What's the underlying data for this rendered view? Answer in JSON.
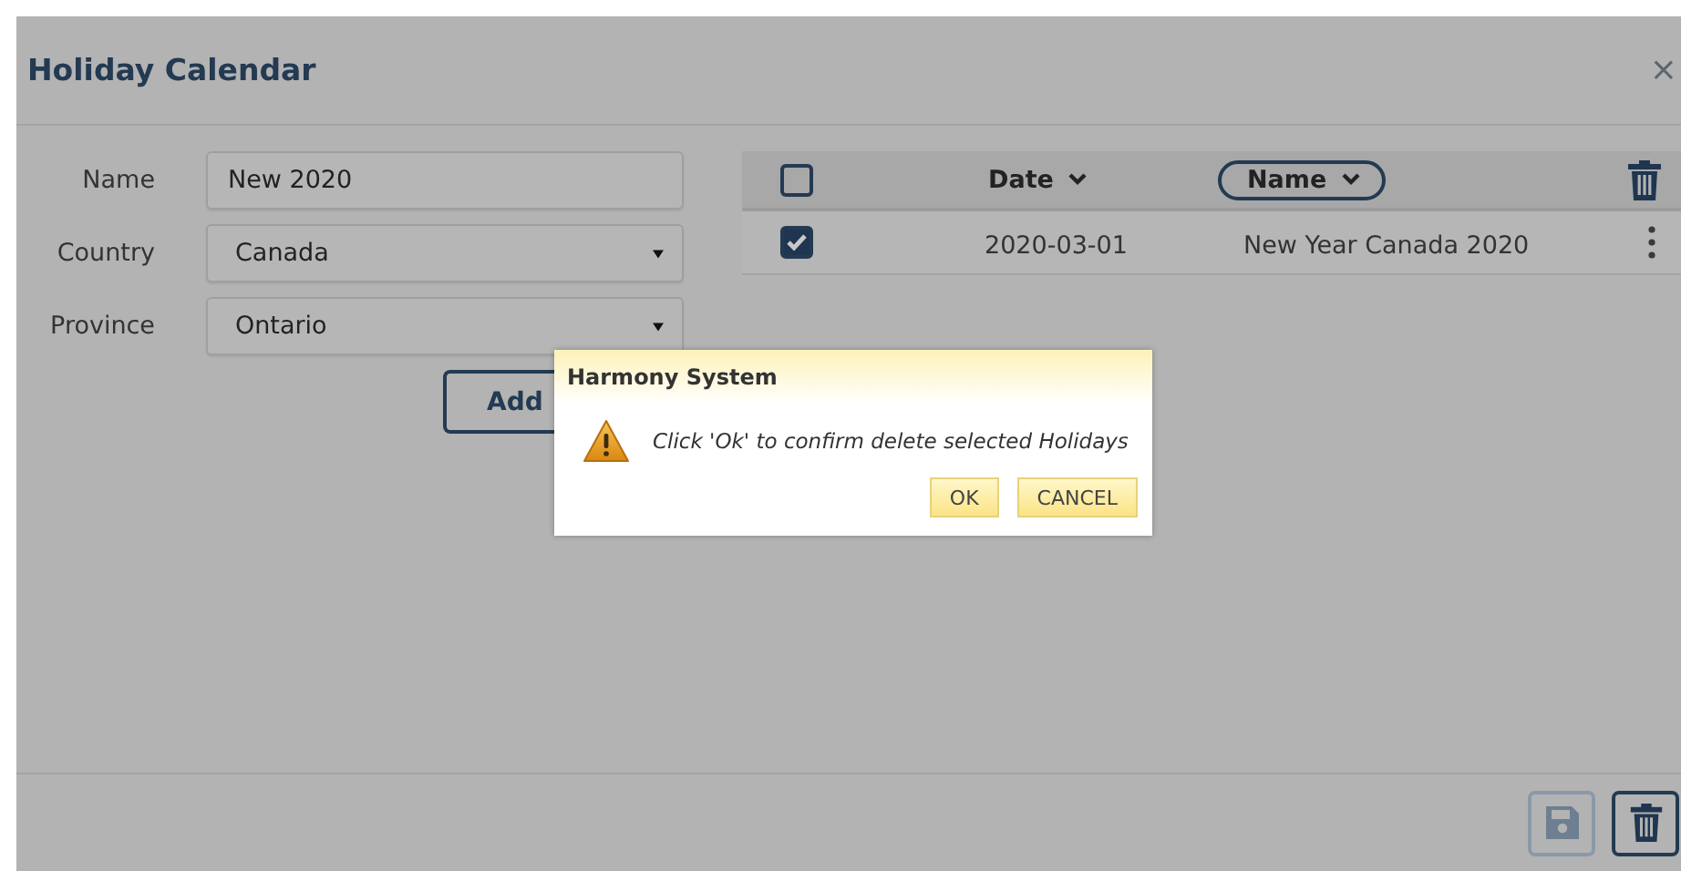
{
  "window": {
    "title": "Holiday Calendar",
    "close": "×"
  },
  "form": {
    "fields": [
      {
        "label": "Name",
        "kind": "text",
        "value": "New 2020"
      },
      {
        "label": "Country",
        "kind": "select",
        "value": "Canada"
      },
      {
        "label": "Province",
        "kind": "select",
        "value": "Ontario"
      }
    ],
    "add_button": "Add"
  },
  "table": {
    "select_all_checked": false,
    "columns": [
      {
        "label": "Date",
        "selected": false
      },
      {
        "label": "Name",
        "selected": true
      }
    ],
    "rows": [
      {
        "checked": true,
        "date": "2020-03-01",
        "name": "New Year Canada 2020"
      }
    ]
  },
  "footer": {
    "buttons": [
      {
        "kind": "save",
        "disabled": true
      },
      {
        "kind": "delete",
        "disabled": false
      }
    ]
  },
  "modal": {
    "title": "Harmony System",
    "message": "Click 'Ok' to confirm delete selected Holidays",
    "buttons": [
      "OK",
      "CANCEL"
    ]
  }
}
